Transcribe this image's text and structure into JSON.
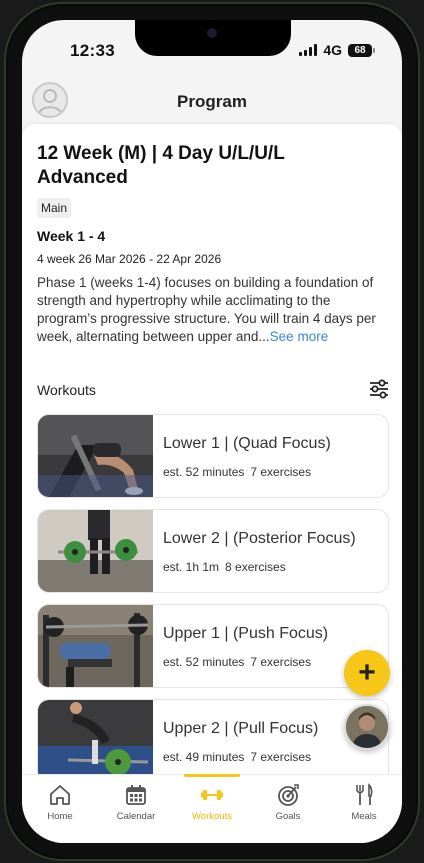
{
  "status_bar": {
    "time": "12:33",
    "network": "4G",
    "battery": "68"
  },
  "header": {
    "title": "Program"
  },
  "program": {
    "title": "12 Week (M) | 4 Day U/L/U/L Advanced",
    "tag": "Main",
    "week_title": "Week 1 - 4",
    "week_dates": "4 week 26 Mar 2026 - 22 Apr 2026",
    "description": "Phase 1 (weeks 1-4) focuses on building a foundation of strength and hypertrophy while acclimating to the program’s progressive structure. You will train 4 days per week, alternating between upper and...",
    "see_more": "See more"
  },
  "workouts": {
    "label": "Workouts",
    "items": [
      {
        "name": "Lower 1 | (Quad Focus)",
        "duration": "est. 52 minutes",
        "exercises": "7 exercises"
      },
      {
        "name": "Lower 2 | (Posterior Focus)",
        "duration": "est. 1h 1m",
        "exercises": "8 exercises"
      },
      {
        "name": "Upper 1 | (Push Focus)",
        "duration": "est. 52 minutes",
        "exercises": "7 exercises"
      },
      {
        "name": "Upper 2 | (Pull Focus)",
        "duration": "est. 49 minutes",
        "exercises": "7 exercises"
      }
    ]
  },
  "fab": {
    "label": "+"
  },
  "tabs": [
    {
      "label": "Home",
      "icon": "home-icon"
    },
    {
      "label": "Calendar",
      "icon": "calendar-icon"
    },
    {
      "label": "Workouts",
      "icon": "dumbbell-icon",
      "active": true
    },
    {
      "label": "Goals",
      "icon": "target-icon"
    },
    {
      "label": "Meals",
      "icon": "fork-knife-icon"
    }
  ],
  "colors": {
    "accent": "#f6c619",
    "active_label": "#f0b800",
    "link": "#3a86d4"
  }
}
